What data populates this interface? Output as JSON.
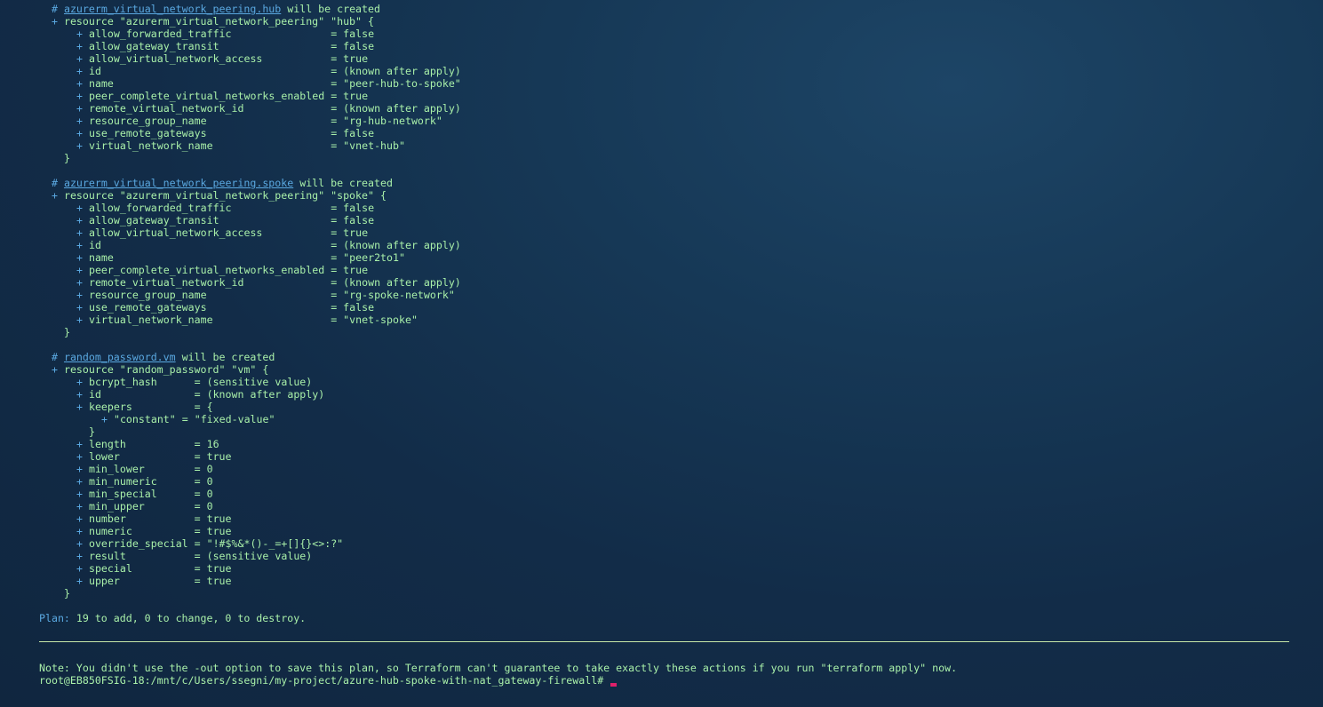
{
  "terminal": {
    "blocks": [
      {
        "comment_hash": "#",
        "address": "azurerm_virtual_network_peering.hub",
        "will_be_created": "will be created",
        "resource_line": "resource \"azurerm_virtual_network_peering\" \"hub\" {",
        "attributes": [
          {
            "key": "allow_forwarded_traffic               ",
            "value": "= false"
          },
          {
            "key": "allow_gateway_transit                 ",
            "value": "= false"
          },
          {
            "key": "allow_virtual_network_access          ",
            "value": "= true"
          },
          {
            "key": "id                                    ",
            "value": "= (known after apply)"
          },
          {
            "key": "name                                  ",
            "value": "= \"peer-hub-to-spoke\""
          },
          {
            "key": "peer_complete_virtual_networks_enabled",
            "value": "= true"
          },
          {
            "key": "remote_virtual_network_id             ",
            "value": "= (known after apply)"
          },
          {
            "key": "resource_group_name                   ",
            "value": "= \"rg-hub-network\""
          },
          {
            "key": "use_remote_gateways                   ",
            "value": "= false"
          },
          {
            "key": "virtual_network_name                  ",
            "value": "= \"vnet-hub\""
          }
        ],
        "close_brace": "}"
      },
      {
        "comment_hash": "#",
        "address": "azurerm_virtual_network_peering.spoke",
        "will_be_created": "will be created",
        "resource_line": "resource \"azurerm_virtual_network_peering\" \"spoke\" {",
        "attributes": [
          {
            "key": "allow_forwarded_traffic               ",
            "value": "= false"
          },
          {
            "key": "allow_gateway_transit                 ",
            "value": "= false"
          },
          {
            "key": "allow_virtual_network_access          ",
            "value": "= true"
          },
          {
            "key": "id                                    ",
            "value": "= (known after apply)"
          },
          {
            "key": "name                                  ",
            "value": "= \"peer2to1\""
          },
          {
            "key": "peer_complete_virtual_networks_enabled",
            "value": "= true"
          },
          {
            "key": "remote_virtual_network_id             ",
            "value": "= (known after apply)"
          },
          {
            "key": "resource_group_name                   ",
            "value": "= \"rg-spoke-network\""
          },
          {
            "key": "use_remote_gateways                   ",
            "value": "= false"
          },
          {
            "key": "virtual_network_name                  ",
            "value": "= \"vnet-spoke\""
          }
        ],
        "close_brace": "}"
      },
      {
        "comment_hash": "#",
        "address": "random_password.vm",
        "will_be_created": "will be created",
        "resource_line": "resource \"random_password\" \"vm\" {",
        "attributes": [
          {
            "key": "bcrypt_hash     ",
            "value": "= (sensitive value)"
          },
          {
            "key": "id              ",
            "value": "= (known after apply)"
          },
          {
            "key": "keepers         ",
            "value": "= {"
          },
          {
            "key": "\"constant\"",
            "value": "= \"fixed-value\"",
            "nested": true
          },
          {
            "key": "}",
            "value": "",
            "closing": true
          },
          {
            "key": "length          ",
            "value": "= 16"
          },
          {
            "key": "lower           ",
            "value": "= true"
          },
          {
            "key": "min_lower       ",
            "value": "= 0"
          },
          {
            "key": "min_numeric     ",
            "value": "= 0"
          },
          {
            "key": "min_special     ",
            "value": "= 0"
          },
          {
            "key": "min_upper       ",
            "value": "= 0"
          },
          {
            "key": "number          ",
            "value": "= true"
          },
          {
            "key": "numeric         ",
            "value": "= true"
          },
          {
            "key": "override_special",
            "value": "= \"!#$%&*()-_=+[]{}<>:?\""
          },
          {
            "key": "result          ",
            "value": "= (sensitive value)"
          },
          {
            "key": "special         ",
            "value": "= true"
          },
          {
            "key": "upper           ",
            "value": "= true"
          }
        ],
        "close_brace": "}"
      }
    ],
    "plan_label": "Plan:",
    "plan_text": "19 to add, 0 to change, 0 to destroy.",
    "note": "Note: You didn't use the -out option to save this plan, so Terraform can't guarantee to take exactly these actions if you run \"terraform apply\" now.",
    "prompt": "root@EB850FSIG-18:/mnt/c/Users/ssegni/my-project/azure-hub-spoke-with-nat_gateway-firewall#",
    "colors": {
      "background": "#122c48",
      "text": "#a9f0a9",
      "accent": "#5aa8e0",
      "cursor": "#e0206a",
      "divider": "#c7e8a8"
    }
  }
}
